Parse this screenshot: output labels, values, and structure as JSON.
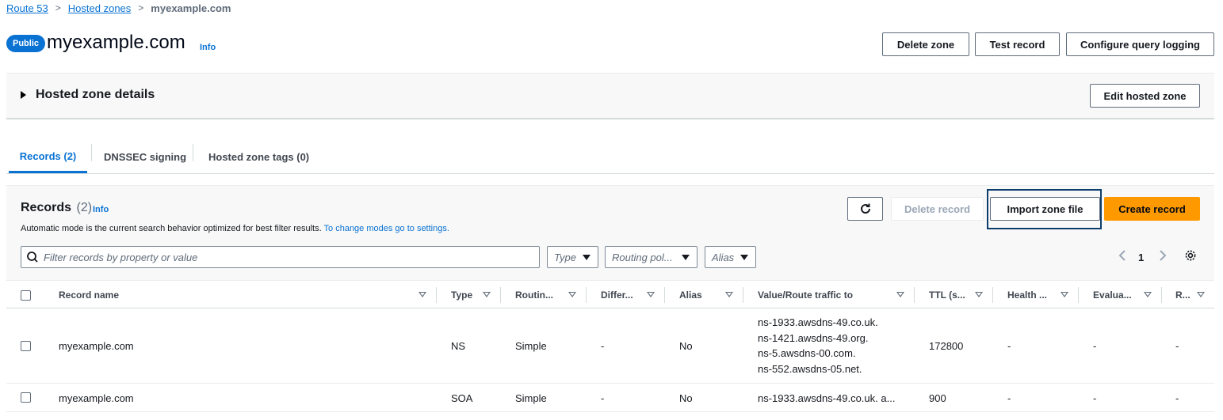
{
  "breadcrumb": {
    "items": [
      {
        "label": "Route 53"
      },
      {
        "label": "Hosted zones"
      }
    ],
    "current": "myexample.com"
  },
  "header": {
    "badge": "Public",
    "title": "myexample.com",
    "info": "Info",
    "actions": {
      "delete_zone": "Delete zone",
      "test_record": "Test record",
      "configure_logging": "Configure query logging"
    }
  },
  "details": {
    "title": "Hosted zone details",
    "edit_button": "Edit hosted zone"
  },
  "tabs": [
    {
      "label": "Records (2)",
      "active": true
    },
    {
      "label": "DNSSEC signing",
      "active": false
    },
    {
      "label": "Hosted zone tags (0)",
      "active": false
    }
  ],
  "records": {
    "title": "Records",
    "count": "(2)",
    "info": "Info",
    "description": "Automatic mode is the current search behavior optimized for best filter results.",
    "description_link": "To change modes go to settings.",
    "buttons": {
      "delete": "Delete record",
      "import": "Import zone file",
      "create": "Create record"
    },
    "search": {
      "placeholder": "Filter records by property or value"
    },
    "filters": {
      "type": "Type",
      "routing": "Routing pol...",
      "alias": "Alias"
    },
    "pagination": {
      "page": "1"
    },
    "columns": [
      "Record name",
      "Type",
      "Routin...",
      "Differ...",
      "Alias",
      "Value/Route traffic to",
      "TTL (s...",
      "Health ...",
      "Evalua...",
      "R..."
    ],
    "rows": [
      {
        "name": "myexample.com",
        "type": "NS",
        "routing": "Simple",
        "differentiator": "-",
        "alias": "No",
        "values": [
          "ns-1933.awsdns-49.co.uk.",
          "ns-1421.awsdns-49.org.",
          "ns-5.awsdns-00.com.",
          "ns-552.awsdns-05.net."
        ],
        "ttl": "172800",
        "health": "-",
        "evaluate": "-",
        "record_id": "-"
      },
      {
        "name": "myexample.com",
        "type": "SOA",
        "routing": "Simple",
        "differentiator": "-",
        "alias": "No",
        "values": [
          "ns-1933.awsdns-49.co.uk. a..."
        ],
        "ttl": "900",
        "health": "-",
        "evaluate": "-",
        "record_id": "-"
      }
    ]
  },
  "colors": {
    "link": "#0972d3",
    "primary_button": "#ff9900",
    "badge": "#0972d3",
    "focus_outline": "#0b3d6b"
  }
}
